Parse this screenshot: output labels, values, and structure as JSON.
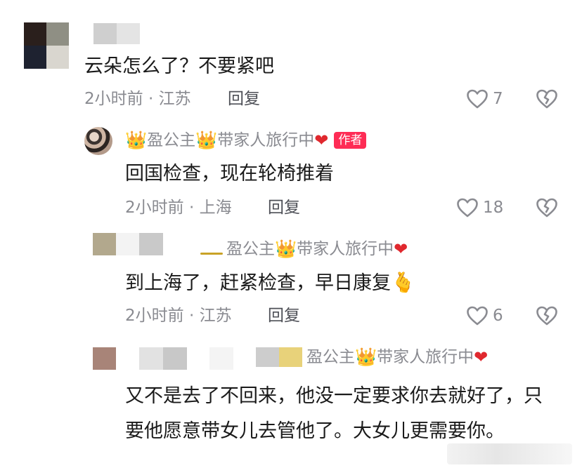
{
  "comments": [
    {
      "text": "云朵怎么了？不要紧吧",
      "time_location": "2小时前 · 江苏",
      "reply_label": "回复",
      "like_count": "7"
    },
    {
      "user": {
        "name": "盈公主",
        "suffix": "带家人旅行中",
        "badge": "作者"
      },
      "text": "回国检查，现在轮椅推着",
      "time_location": "2小时前 · 上海",
      "reply_label": "回复",
      "like_count": "18"
    },
    {
      "reply_to": {
        "name": "盈公主",
        "suffix": "带家人旅行中"
      },
      "text": "到上海了，赶紧检查，早日康复",
      "time_location": "2小时前 · 江苏",
      "reply_label": "回复",
      "like_count": "6"
    },
    {
      "reply_to": {
        "name": "盈公主",
        "suffix": "带家人旅行中"
      },
      "text": "又不是去了不回来，他没一定要求你去就好了，只要他愿意带女儿去管他了。大女儿更需要你。"
    }
  ],
  "icons": {
    "like": "heart-outline-icon",
    "dislike": "broken-heart-icon",
    "crown": "crown-emoji",
    "heart": "red-heart-emoji",
    "accent_badge_color": "#fe2c55"
  }
}
